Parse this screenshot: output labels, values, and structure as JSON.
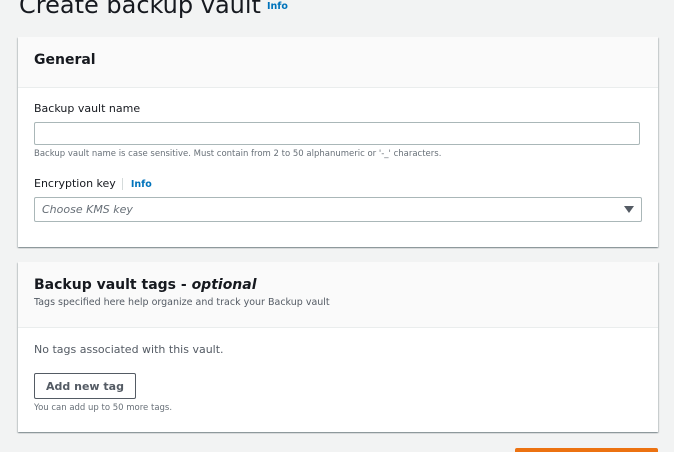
{
  "page": {
    "title": "Create backup vault",
    "info_label": "Info"
  },
  "general": {
    "title": "General",
    "vault_name": {
      "label": "Backup vault name",
      "value": "",
      "placeholder": "",
      "hint": "Backup vault name is case sensitive. Must contain from 2 to 50 alphanumeric or '-_' characters."
    },
    "encryption": {
      "label": "Encryption key",
      "info_label": "Info",
      "placeholder": "Choose KMS key"
    }
  },
  "tags": {
    "title": "Backup vault tags",
    "title_separator": " - ",
    "optional_label": "optional",
    "description": "Tags specified here help organize and track your Backup vault",
    "empty_text": "No tags associated with this vault.",
    "add_button_label": "Add new tag",
    "limit_hint": "You can add up to 50 more tags."
  },
  "colors": {
    "accent_link": "#0073bb",
    "primary_orange": "#ec7211",
    "background": "#f2f3f3"
  }
}
